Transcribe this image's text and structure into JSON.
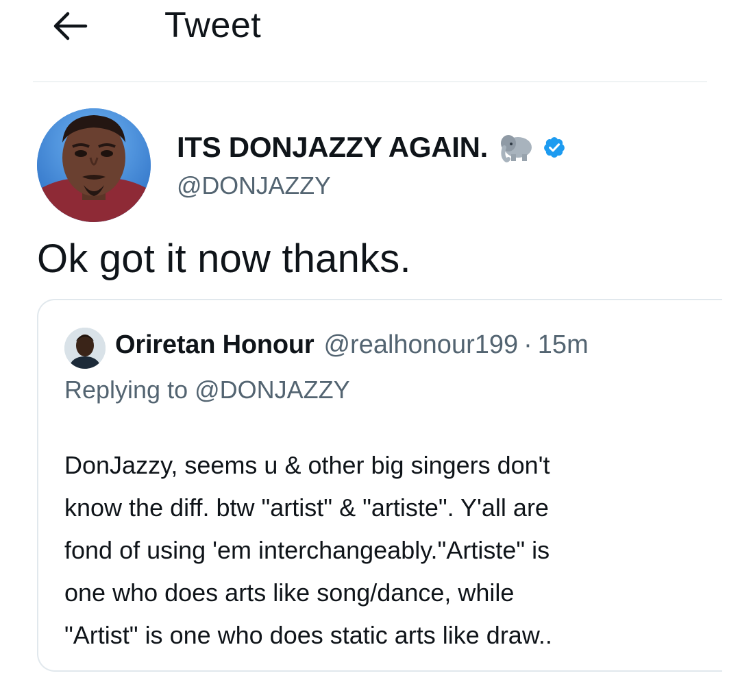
{
  "header": {
    "title": "Tweet",
    "back_icon": "arrow-left-icon"
  },
  "tweet": {
    "author": {
      "name": "ITS DONJAZZY AGAIN.",
      "emoji": "elephant-icon",
      "verified_icon": "verified-badge-icon",
      "handle": "@DONJAZZY"
    },
    "text": "Ok got it now thanks.",
    "quoted": {
      "name": "Oriretan Honour",
      "handle": "@realhonour199",
      "separator": "·",
      "time": "15m",
      "replying_to": "Replying to @DONJAZZY",
      "lines": [
        "DonJazzy, seems u & other big singers don't",
        "know the diff. btw \"artist\" & \"artiste\". Y'all are",
        "fond of using 'em interchangeably.\"Artiste\" is",
        "one who does arts like song/dance, while",
        "\"Artist\" is one who does static arts like draw.."
      ]
    }
  },
  "colors": {
    "text_primary": "#0f1419",
    "text_secondary": "#536471",
    "verified_blue": "#1d9bf0",
    "border": "#e1e8ed"
  }
}
